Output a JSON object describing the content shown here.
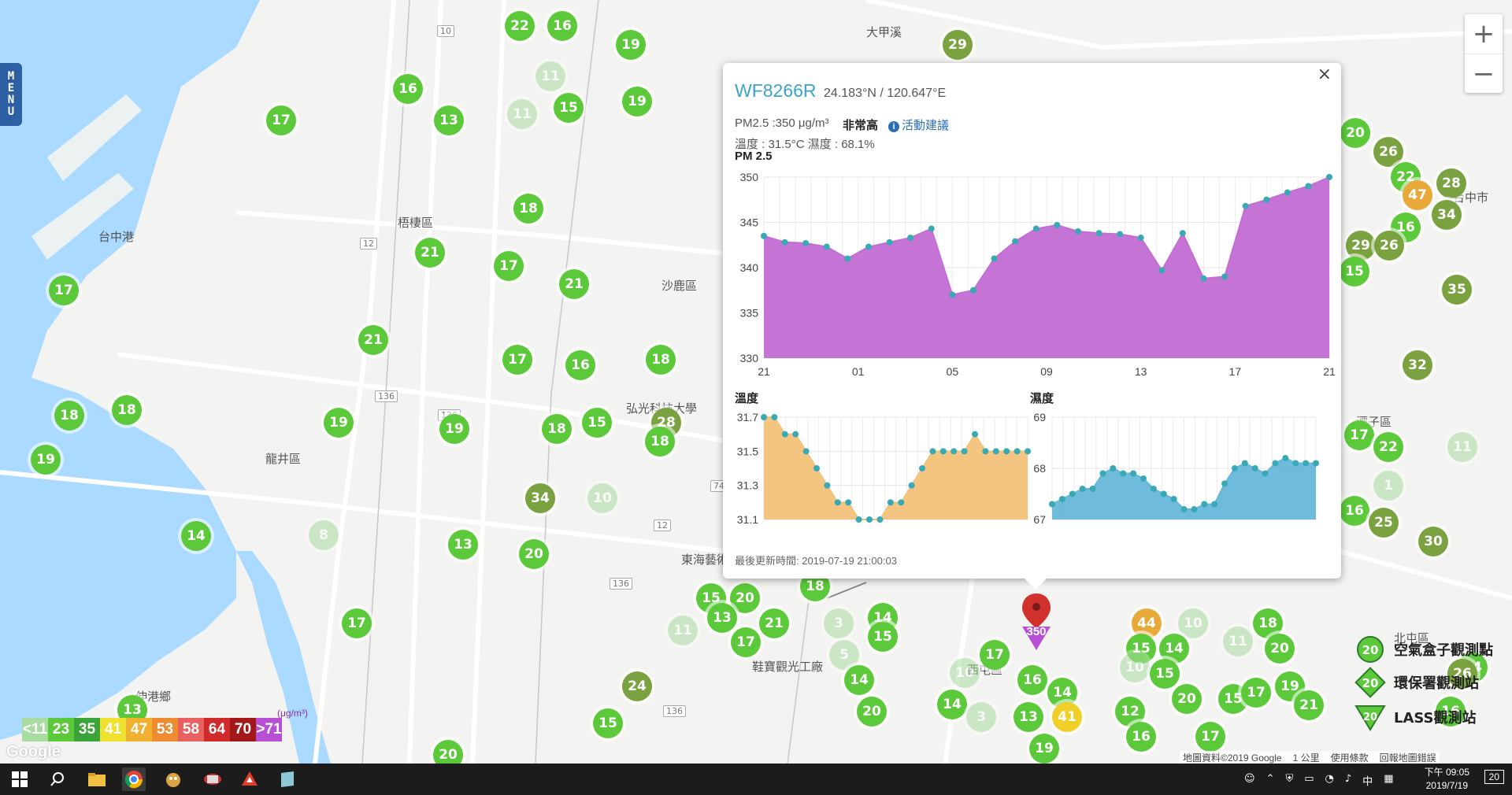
{
  "app": {
    "menu_label": "MENU"
  },
  "zoom": {
    "in": "+",
    "out": "−"
  },
  "map_labels": [
    {
      "text": "梧棲區",
      "x": 505,
      "y": 272
    },
    {
      "text": "沙鹿區",
      "x": 840,
      "y": 352
    },
    {
      "text": "龍井區",
      "x": 337,
      "y": 572
    },
    {
      "text": "台中港",
      "x": 125,
      "y": 290
    },
    {
      "text": "東海藝術街",
      "x": 865,
      "y": 700
    },
    {
      "text": "鞋寶觀光工廠",
      "x": 955,
      "y": 836
    },
    {
      "text": "弘光科技大學",
      "x": 795,
      "y": 508
    },
    {
      "text": "伸港鄉",
      "x": 172,
      "y": 874
    },
    {
      "text": "潭子區",
      "x": 1722,
      "y": 525
    },
    {
      "text": "北屯區",
      "x": 1770,
      "y": 800
    },
    {
      "text": "台中市",
      "x": 1845,
      "y": 240
    },
    {
      "text": "西屯區",
      "x": 1228,
      "y": 840
    },
    {
      "text": "大甲溪",
      "x": 1100,
      "y": 30
    }
  ],
  "road_shields": [
    {
      "text": "10",
      "x": 555,
      "y": 32
    },
    {
      "text": "12",
      "x": 457,
      "y": 302
    },
    {
      "text": "136",
      "x": 476,
      "y": 496
    },
    {
      "text": "136",
      "x": 556,
      "y": 520
    },
    {
      "text": "12",
      "x": 830,
      "y": 660
    },
    {
      "text": "136",
      "x": 774,
      "y": 734
    },
    {
      "text": "74",
      "x": 902,
      "y": 610
    },
    {
      "text": "136",
      "x": 842,
      "y": 896
    }
  ],
  "markers": [
    {
      "v": "22",
      "x": 660,
      "y": 33,
      "c": "#5cc93a"
    },
    {
      "v": "16",
      "x": 714,
      "y": 33,
      "c": "#5cc93a"
    },
    {
      "v": "19",
      "x": 801,
      "y": 57,
      "c": "#5cc93a"
    },
    {
      "v": "29",
      "x": 1216,
      "y": 57,
      "c": "#7aa241"
    },
    {
      "v": "16",
      "x": 518,
      "y": 113,
      "c": "#5cc93a"
    },
    {
      "v": "11",
      "x": 699,
      "y": 97,
      "c": "#a9dca0",
      "f": true
    },
    {
      "v": "11",
      "x": 663,
      "y": 145,
      "c": "#a9dca0",
      "f": true
    },
    {
      "v": "15",
      "x": 722,
      "y": 137,
      "c": "#5cc93a"
    },
    {
      "v": "19",
      "x": 809,
      "y": 129,
      "c": "#5cc93a"
    },
    {
      "v": "17",
      "x": 357,
      "y": 153,
      "c": "#5cc93a"
    },
    {
      "v": "13",
      "x": 570,
      "y": 153,
      "c": "#5cc93a"
    },
    {
      "v": "18",
      "x": 671,
      "y": 265,
      "c": "#5cc93a"
    },
    {
      "v": "21",
      "x": 546,
      "y": 321,
      "c": "#5cc93a"
    },
    {
      "v": "17",
      "x": 646,
      "y": 338,
      "c": "#5cc93a"
    },
    {
      "v": "21",
      "x": 729,
      "y": 361,
      "c": "#5cc93a"
    },
    {
      "v": "17",
      "x": 81,
      "y": 369,
      "c": "#5cc93a"
    },
    {
      "v": "21",
      "x": 474,
      "y": 432,
      "c": "#5cc93a"
    },
    {
      "v": "17",
      "x": 657,
      "y": 457,
      "c": "#5cc93a"
    },
    {
      "v": "16",
      "x": 737,
      "y": 464,
      "c": "#5cc93a"
    },
    {
      "v": "18",
      "x": 839,
      "y": 457,
      "c": "#5cc93a"
    },
    {
      "v": "18",
      "x": 88,
      "y": 528,
      "c": "#5cc93a"
    },
    {
      "v": "18",
      "x": 161,
      "y": 521,
      "c": "#5cc93a"
    },
    {
      "v": "19",
      "x": 430,
      "y": 537,
      "c": "#5cc93a"
    },
    {
      "v": "19",
      "x": 577,
      "y": 545,
      "c": "#5cc93a"
    },
    {
      "v": "18",
      "x": 707,
      "y": 545,
      "c": "#5cc93a"
    },
    {
      "v": "15",
      "x": 758,
      "y": 537,
      "c": "#5cc93a"
    },
    {
      "v": "28",
      "x": 846,
      "y": 537,
      "c": "#7aa241"
    },
    {
      "v": "18",
      "x": 838,
      "y": 561,
      "c": "#5cc93a"
    },
    {
      "v": "19",
      "x": 58,
      "y": 584,
      "c": "#5cc93a"
    },
    {
      "v": "34",
      "x": 686,
      "y": 633,
      "c": "#7aa241"
    },
    {
      "v": "10",
      "x": 765,
      "y": 633,
      "c": "#a9dca0",
      "f": true
    },
    {
      "v": "14",
      "x": 249,
      "y": 681,
      "c": "#5cc93a"
    },
    {
      "v": "8",
      "x": 411,
      "y": 680,
      "c": "#a9dca0",
      "f": true
    },
    {
      "v": "13",
      "x": 588,
      "y": 692,
      "c": "#5cc93a"
    },
    {
      "v": "20",
      "x": 678,
      "y": 704,
      "c": "#5cc93a"
    },
    {
      "v": "17",
      "x": 453,
      "y": 792,
      "c": "#5cc93a"
    },
    {
      "v": "15",
      "x": 903,
      "y": 760,
      "c": "#5cc93a"
    },
    {
      "v": "20",
      "x": 946,
      "y": 760,
      "c": "#5cc93a"
    },
    {
      "v": "13",
      "x": 917,
      "y": 785,
      "c": "#5cc93a"
    },
    {
      "v": "11",
      "x": 867,
      "y": 801,
      "c": "#a9dca0",
      "f": true
    },
    {
      "v": "21",
      "x": 983,
      "y": 792,
      "c": "#5cc93a"
    },
    {
      "v": "17",
      "x": 947,
      "y": 816,
      "c": "#5cc93a"
    },
    {
      "v": "18",
      "x": 1035,
      "y": 745,
      "c": "#5cc93a"
    },
    {
      "v": "3",
      "x": 1065,
      "y": 792,
      "c": "#a9dca0",
      "f": true
    },
    {
      "v": "14",
      "x": 1121,
      "y": 785,
      "c": "#5cc93a"
    },
    {
      "v": "15",
      "x": 1121,
      "y": 809,
      "c": "#5cc93a"
    },
    {
      "v": "5",
      "x": 1072,
      "y": 832,
      "c": "#a9dca0",
      "f": true
    },
    {
      "v": "14",
      "x": 1091,
      "y": 864,
      "c": "#5cc93a"
    },
    {
      "v": "20",
      "x": 1107,
      "y": 904,
      "c": "#5cc93a"
    },
    {
      "v": "17",
      "x": 1263,
      "y": 832,
      "c": "#5cc93a"
    },
    {
      "v": "10",
      "x": 1225,
      "y": 855,
      "c": "#a9dca0",
      "f": true
    },
    {
      "v": "16",
      "x": 1311,
      "y": 864,
      "c": "#5cc93a"
    },
    {
      "v": "14",
      "x": 1349,
      "y": 880,
      "c": "#5cc93a"
    },
    {
      "v": "14",
      "x": 1209,
      "y": 895,
      "c": "#5cc93a"
    },
    {
      "v": "3",
      "x": 1246,
      "y": 911,
      "c": "#a9dca0",
      "f": true
    },
    {
      "v": "13",
      "x": 1306,
      "y": 911,
      "c": "#5cc93a"
    },
    {
      "v": "41",
      "x": 1355,
      "y": 911,
      "c": "#f0d028"
    },
    {
      "v": "19",
      "x": 1326,
      "y": 951,
      "c": "#5cc93a"
    },
    {
      "v": "24",
      "x": 809,
      "y": 872,
      "c": "#7aa241"
    },
    {
      "v": "15",
      "x": 772,
      "y": 919,
      "c": "#5cc93a"
    },
    {
      "v": "20",
      "x": 569,
      "y": 959,
      "c": "#5cc93a"
    },
    {
      "v": "13",
      "x": 168,
      "y": 902,
      "c": "#5cc93a"
    },
    {
      "v": "44",
      "x": 1456,
      "y": 792,
      "c": "#e8a93a"
    },
    {
      "v": "10",
      "x": 1515,
      "y": 792,
      "c": "#a9dca0",
      "f": true
    },
    {
      "v": "11",
      "x": 1572,
      "y": 815,
      "c": "#a9dca0",
      "f": true
    },
    {
      "v": "18",
      "x": 1610,
      "y": 792,
      "c": "#5cc93a"
    },
    {
      "v": "15",
      "x": 1449,
      "y": 824,
      "c": "#5cc93a"
    },
    {
      "v": "14",
      "x": 1491,
      "y": 824,
      "c": "#5cc93a"
    },
    {
      "v": "20",
      "x": 1625,
      "y": 824,
      "c": "#5cc93a"
    },
    {
      "v": "10",
      "x": 1441,
      "y": 848,
      "c": "#a9dca0",
      "f": true
    },
    {
      "v": "15",
      "x": 1479,
      "y": 856,
      "c": "#5cc93a"
    },
    {
      "v": "20",
      "x": 1507,
      "y": 888,
      "c": "#5cc93a"
    },
    {
      "v": "15",
      "x": 1566,
      "y": 888,
      "c": "#5cc93a"
    },
    {
      "v": "17",
      "x": 1595,
      "y": 880,
      "c": "#5cc93a"
    },
    {
      "v": "19",
      "x": 1638,
      "y": 872,
      "c": "#5cc93a"
    },
    {
      "v": "21",
      "x": 1662,
      "y": 896,
      "c": "#5cc93a"
    },
    {
      "v": "12",
      "x": 1435,
      "y": 904,
      "c": "#5cc93a"
    },
    {
      "v": "16",
      "x": 1449,
      "y": 936,
      "c": "#5cc93a"
    },
    {
      "v": "17",
      "x": 1537,
      "y": 936,
      "c": "#5cc93a"
    },
    {
      "v": "20",
      "x": 1721,
      "y": 169,
      "c": "#5cc93a"
    },
    {
      "v": "26",
      "x": 1763,
      "y": 193,
      "c": "#7aa241"
    },
    {
      "v": "22",
      "x": 1785,
      "y": 225,
      "c": "#5cc93a"
    },
    {
      "v": "47",
      "x": 1800,
      "y": 248,
      "c": "#e8a93a"
    },
    {
      "v": "28",
      "x": 1843,
      "y": 233,
      "c": "#7aa241"
    },
    {
      "v": "16",
      "x": 1785,
      "y": 289,
      "c": "#5cc93a"
    },
    {
      "v": "34",
      "x": 1837,
      "y": 273,
      "c": "#7aa241"
    },
    {
      "v": "29",
      "x": 1728,
      "y": 312,
      "c": "#7aa241"
    },
    {
      "v": "26",
      "x": 1764,
      "y": 312,
      "c": "#7aa241"
    },
    {
      "v": "15",
      "x": 1720,
      "y": 345,
      "c": "#5cc93a"
    },
    {
      "v": "35",
      "x": 1850,
      "y": 368,
      "c": "#7aa241"
    },
    {
      "v": "32",
      "x": 1800,
      "y": 464,
      "c": "#7aa241"
    },
    {
      "v": "17",
      "x": 1726,
      "y": 553,
      "c": "#5cc93a"
    },
    {
      "v": "22",
      "x": 1763,
      "y": 568,
      "c": "#5cc93a"
    },
    {
      "v": "11",
      "x": 1857,
      "y": 568,
      "c": "#a9dca0",
      "f": true
    },
    {
      "v": "1",
      "x": 1763,
      "y": 617,
      "c": "#a9dca0",
      "f": true
    },
    {
      "v": "16",
      "x": 1720,
      "y": 649,
      "c": "#5cc93a"
    },
    {
      "v": "25",
      "x": 1757,
      "y": 664,
      "c": "#7aa241"
    },
    {
      "v": "30",
      "x": 1820,
      "y": 688,
      "c": "#7aa241"
    },
    {
      "v": "24",
      "x": 1870,
      "y": 848,
      "c": "#5cc93a"
    },
    {
      "v": "26",
      "x": 1857,
      "y": 856,
      "c": "#7aa241"
    },
    {
      "v": "16",
      "x": 1842,
      "y": 904,
      "c": "#5cc93a"
    }
  ],
  "highlight_marker": {
    "value": "350",
    "color": "#b64fd3"
  },
  "popup": {
    "device_id": "WF8266R",
    "coords": "24.183°N / 120.647°E",
    "pm_text": "PM2.5 :350 μg/m³",
    "level": "非常高",
    "advice": "活動建議",
    "temp_humid": "溫度 : 31.5°C 濕度 : 68.1%",
    "pm_title": "PM 2.5",
    "temp_title": "溫度",
    "humid_title": "濕度",
    "updated": "最後更新時間: 2019-07-19 21:00:03",
    "close": "×"
  },
  "chart_data": [
    {
      "type": "area",
      "title": "PM 2.5",
      "color": "#c26dd4",
      "ylim": [
        330,
        350
      ],
      "yticks": [
        350,
        345,
        340,
        335,
        330
      ],
      "xticks": [
        "21",
        "01",
        "05",
        "09",
        "13",
        "17",
        "21"
      ],
      "values": [
        343.5,
        342.8,
        342.7,
        342.3,
        341.0,
        342.3,
        342.8,
        343.3,
        344.3,
        337.0,
        337.5,
        341.0,
        342.9,
        344.3,
        344.7,
        344.0,
        343.8,
        343.7,
        343.3,
        339.7,
        343.8,
        338.8,
        339.0,
        346.8,
        347.5,
        348.3,
        349.0,
        350.0
      ]
    },
    {
      "type": "area",
      "title": "溫度",
      "color": "#f2c27a",
      "ylim": [
        31.1,
        31.7
      ],
      "yticks": [
        31.7,
        31.5,
        31.3,
        31.1
      ],
      "values": [
        31.7,
        31.7,
        31.6,
        31.6,
        31.5,
        31.4,
        31.3,
        31.2,
        31.2,
        31.1,
        31.1,
        31.1,
        31.2,
        31.2,
        31.3,
        31.4,
        31.5,
        31.5,
        31.5,
        31.5,
        31.6,
        31.5,
        31.5,
        31.5,
        31.5,
        31.5
      ]
    },
    {
      "type": "area",
      "title": "濕度",
      "color": "#66b7d9",
      "ylim": [
        67,
        69
      ],
      "yticks": [
        69,
        68,
        67
      ],
      "values": [
        67.3,
        67.4,
        67.5,
        67.6,
        67.6,
        67.9,
        68.0,
        67.9,
        67.9,
        67.8,
        67.6,
        67.5,
        67.4,
        67.2,
        67.2,
        67.3,
        67.3,
        67.7,
        68.0,
        68.1,
        68.0,
        67.9,
        68.1,
        68.2,
        68.1,
        68.1,
        68.1
      ]
    }
  ],
  "legend": {
    "unit": "(μg/m³)",
    "items": [
      {
        "label": "<11",
        "color": "#a9dca0"
      },
      {
        "label": "23",
        "color": "#5cc93a"
      },
      {
        "label": "35",
        "color": "#3aa43a"
      },
      {
        "label": "41",
        "color": "#f0e030"
      },
      {
        "label": "47",
        "color": "#f0b030"
      },
      {
        "label": "53",
        "color": "#ee8a30"
      },
      {
        "label": "58",
        "color": "#e86060"
      },
      {
        "label": "64",
        "color": "#d02a2a"
      },
      {
        "label": "70",
        "color": "#a31818"
      },
      {
        "label": ">71",
        "color": "#b64fd3"
      }
    ]
  },
  "stations": {
    "airbox": {
      "label": "空氣盒子觀測點",
      "value": "20"
    },
    "epa": {
      "label": "環保署觀測站",
      "value": "20"
    },
    "lass": {
      "label": "LASS觀測站",
      "value": "20"
    }
  },
  "attribution": {
    "data": "地圖資料©2019 Google",
    "scale": "1 公里",
    "terms": "使用條款",
    "report": "回報地圖錯誤"
  },
  "google_logo": "Google",
  "taskbar": {
    "time": "下午 09:05",
    "date": "2019/7/19",
    "ime": "中",
    "notif": "20"
  }
}
